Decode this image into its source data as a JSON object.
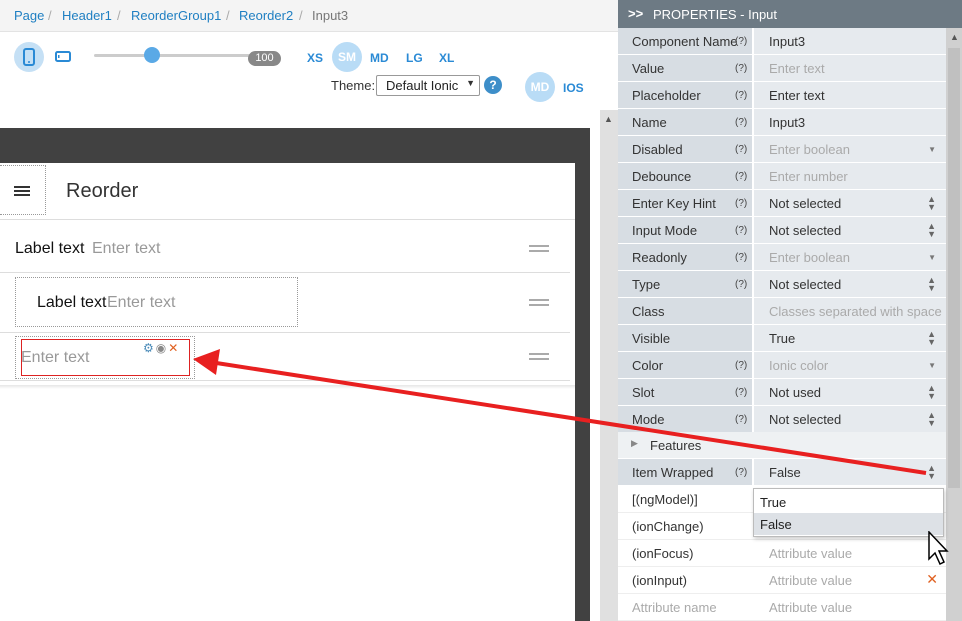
{
  "breadcrumb": {
    "items": [
      "Page",
      "Header1",
      "ReorderGroup1",
      "Reorder2",
      "Input3"
    ],
    "separator": "/"
  },
  "toolbar": {
    "device_phone_icon": "phone-icon",
    "device_tablet_icon": "tablet-icon",
    "zoom_value": "100",
    "breakpoints": [
      "XS",
      "SM",
      "MD",
      "LG",
      "XL"
    ],
    "active_breakpoint": "SM",
    "theme_label": "Theme:",
    "theme_value": "Default Ionic",
    "help_icon": "?",
    "modes": [
      "MD",
      "IOS"
    ],
    "active_mode": "MD"
  },
  "preview": {
    "page_title": "Reorder",
    "rows": [
      {
        "label": "Label text",
        "placeholder": "Enter text"
      },
      {
        "label": "Label text",
        "placeholder": "Enter text"
      },
      {
        "placeholder": "Enter text"
      }
    ]
  },
  "panel": {
    "header_chevron": ">>",
    "title": "PROPERTIES - Input",
    "properties": [
      {
        "name": "Component Name",
        "help": "(?)",
        "value": "Input3",
        "kind": "filled"
      },
      {
        "name": "Value",
        "help": "(?)",
        "value": "Enter text",
        "kind": "placeholder"
      },
      {
        "name": "Placeholder",
        "help": "(?)",
        "value": "Enter text",
        "kind": "filled"
      },
      {
        "name": "Name",
        "help": "(?)",
        "value": "Input3",
        "kind": "filled"
      },
      {
        "name": "Disabled",
        "help": "(?)",
        "value": "Enter boolean",
        "kind": "placeholder"
      },
      {
        "name": "Debounce",
        "help": "(?)",
        "value": "Enter number",
        "kind": "placeholder"
      },
      {
        "name": "Enter Key Hint",
        "help": "(?)",
        "value": "Not selected",
        "kind": "filled"
      },
      {
        "name": "Input Mode",
        "help": "(?)",
        "value": "Not selected",
        "kind": "filled"
      },
      {
        "name": "Readonly",
        "help": "(?)",
        "value": "Enter boolean",
        "kind": "placeholder"
      },
      {
        "name": "Type",
        "help": "(?)",
        "value": "Not selected",
        "kind": "filled"
      },
      {
        "name": "Class",
        "help": "",
        "value": "Classes separated with space",
        "kind": "placeholder"
      },
      {
        "name": "Visible",
        "help": "",
        "value": "True",
        "kind": "filled"
      },
      {
        "name": "Color",
        "help": "(?)",
        "value": "Ionic color",
        "kind": "placeholder"
      },
      {
        "name": "Slot",
        "help": "(?)",
        "value": "Not used",
        "kind": "filled"
      },
      {
        "name": "Mode",
        "help": "(?)",
        "value": "Not selected",
        "kind": "filled"
      }
    ],
    "features_label": "Features",
    "item_wrapped": {
      "name": "Item Wrapped",
      "help": "(?)",
      "value": "False"
    },
    "events": [
      {
        "name": "[(ngModel)]",
        "value": ""
      },
      {
        "name": "(ionChange)",
        "value": ""
      },
      {
        "name": "(ionFocus)",
        "value": "Attribute value"
      },
      {
        "name": "(ionInput)",
        "value": "Attribute value"
      },
      {
        "name": "Attribute name",
        "value": "Attribute value"
      }
    ],
    "dropdown_options": [
      "True",
      "False"
    ],
    "dropdown_selected": "False"
  },
  "colors": {
    "accent": "#2a8ad5",
    "panel_header": "#6d7a84",
    "annotation_arrow": "#e82020"
  }
}
